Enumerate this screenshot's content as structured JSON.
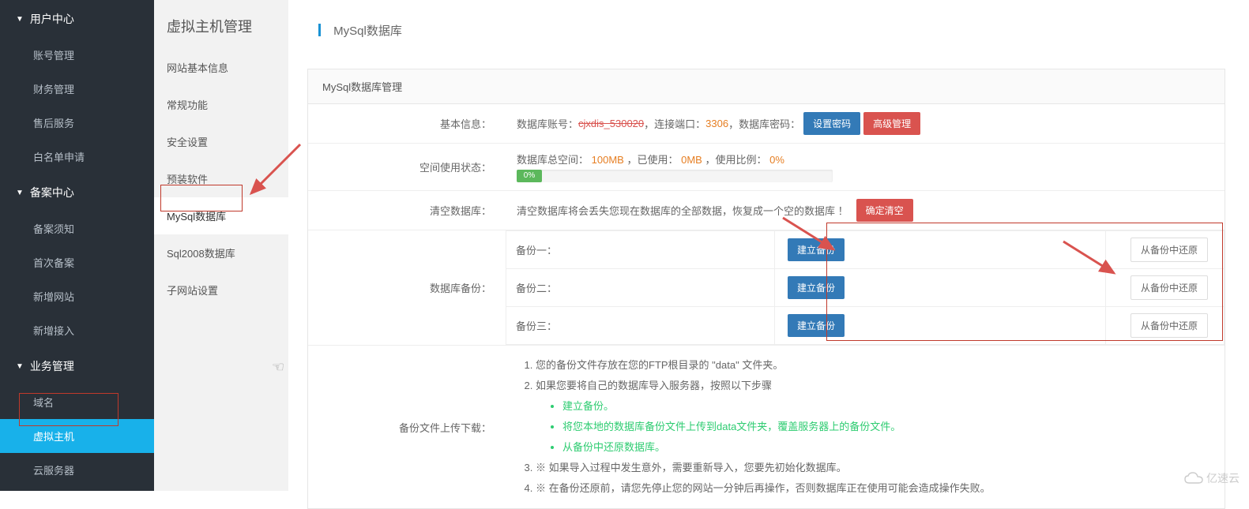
{
  "sidebar1": {
    "groups": [
      {
        "label": "用户中心",
        "items": [
          {
            "label": "账号管理"
          },
          {
            "label": "财务管理"
          },
          {
            "label": "售后服务"
          },
          {
            "label": "白名单申请"
          }
        ]
      },
      {
        "label": "备案中心",
        "items": [
          {
            "label": "备案须知"
          },
          {
            "label": "首次备案"
          },
          {
            "label": "新增网站"
          },
          {
            "label": "新增接入"
          }
        ]
      },
      {
        "label": "业务管理",
        "items": [
          {
            "label": "域名"
          },
          {
            "label": "虚拟主机",
            "active": true
          },
          {
            "label": "云服务器"
          }
        ]
      }
    ]
  },
  "sidebar2": {
    "title": "虚拟主机管理",
    "items": [
      {
        "label": "网站基本信息"
      },
      {
        "label": "常规功能"
      },
      {
        "label": "安全设置"
      },
      {
        "label": "预装软件"
      },
      {
        "label": "MySql数据库",
        "active": true
      },
      {
        "label": "Sql2008数据库"
      },
      {
        "label": "子网站设置"
      }
    ]
  },
  "breadcrumb": "MySql数据库",
  "panel": {
    "title": "MySql数据库管理",
    "basic": {
      "label": "基本信息：",
      "account_label": "数据库账号：",
      "account_value": "cjxdis_530020",
      "port_label": "，连接端口：",
      "port_value": "3306",
      "pwd_label": "，数据库密码：",
      "btn_set_pwd": "设置密码",
      "btn_adv": "高级管理"
    },
    "space": {
      "label": "空间使用状态：",
      "total_label": "数据库总空间：",
      "total_value": "100MB",
      "used_label": "，已使用：",
      "used_value": "0MB",
      "ratio_label": "，使用比例：",
      "ratio_value": "0%",
      "progress_text": "0%"
    },
    "clear": {
      "label": "清空数据库：",
      "warn": "清空数据库将会丢失您现在数据库的全部数据，恢复成一个空的数据库 ！",
      "btn": "确定清空"
    },
    "backup": {
      "label": "数据库备份：",
      "rows": [
        {
          "name": "备份一：",
          "create": "建立备份",
          "restore": "从备份中还原"
        },
        {
          "name": "备份二：",
          "create": "建立备份",
          "restore": "从备份中还原"
        },
        {
          "name": "备份三：",
          "create": "建立备份",
          "restore": "从备份中还原"
        }
      ]
    },
    "tips": {
      "label": "备份文件上传下载：",
      "li1_a": "您的备份文件存放在您的FTP根目录的 ",
      "li1_b": "\"data\"",
      "li1_c": " 文件夹。",
      "li2": "如果您要将自己的数据库导入服务器，按照以下步骤",
      "sub": [
        "建立备份。",
        "将您本地的数据库备份文件上传到data文件夹，覆盖服务器上的备份文件。",
        "从备份中还原数据库。"
      ],
      "li3": "※ 如果导入过程中发生意外，需要重新导入，您要先初始化数据库。",
      "li4": "※ 在备份还原前，请您先停止您的网站一分钟后再操作，否则数据库正在使用可能会造成操作失败。"
    }
  },
  "watermark": "亿速云"
}
